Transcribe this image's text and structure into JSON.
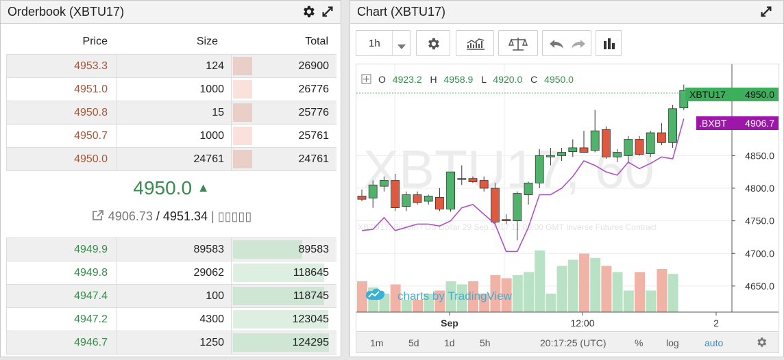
{
  "orderbook": {
    "title": "Orderbook (XBTU17)",
    "headers": {
      "price": "Price",
      "size": "Size",
      "total": "Total"
    },
    "asks": [
      {
        "price": "4953.3",
        "size": "124",
        "total": "26900",
        "depth": 0.2
      },
      {
        "price": "4951.0",
        "size": "1000",
        "total": "26776",
        "depth": 0.2
      },
      {
        "price": "4950.8",
        "size": "15",
        "total": "25776",
        "depth": 0.2
      },
      {
        "price": "4950.7",
        "size": "1000",
        "total": "25761",
        "depth": 0.2
      },
      {
        "price": "4950.0",
        "size": "24761",
        "total": "24761",
        "depth": 0.2
      }
    ],
    "mid": {
      "price": "4950.0",
      "arrow": "▲",
      "index": "4906.73",
      "separator": "/",
      "fair": "4951.34",
      "tail": "| ▯▯▯▯▯"
    },
    "bids": [
      {
        "price": "4949.9",
        "size": "89583",
        "total": "89583",
        "depth": 0.72
      },
      {
        "price": "4949.8",
        "size": "29062",
        "total": "118645",
        "depth": 0.95
      },
      {
        "price": "4947.4",
        "size": "100",
        "total": "118745",
        "depth": 0.95
      },
      {
        "price": "4947.2",
        "size": "4300",
        "total": "123045",
        "depth": 0.99
      },
      {
        "price": "4946.7",
        "size": "1250",
        "total": "124295",
        "depth": 1.0
      }
    ]
  },
  "chart": {
    "title": "Chart (XBTU17)",
    "interval": "1h",
    "legend": {
      "o_label": "O",
      "o": "4923.2",
      "h_label": "H",
      "h": "4958.9",
      "l_label": "L",
      "l": "4920.0",
      "c_label": "C",
      "c": "4950.0"
    },
    "watermark": "XBTU17, 60",
    "subtitle_watermark": "XBTU17: Bitcoin / US Dollar 29 Sep 2017 12:00:00 GMT Inverse Futures Contract",
    "branding": "charts by TradingView",
    "price_labels": [
      {
        "name": "XBTU17",
        "value": "4950.0",
        "color": "#3dae5c"
      },
      {
        "name": ".BXBT",
        "value": "4906.7",
        "color": "#9c16a8"
      }
    ],
    "y_ticks": [
      "4850.0",
      "4800.0",
      "4750.0",
      "4700.0",
      "4650.0"
    ],
    "x_ticks": [
      "Sep",
      "12:00",
      "2"
    ],
    "bottom": {
      "ranges": [
        "1m",
        "5d",
        "1d",
        "5h"
      ],
      "time": "20:17:25 (UTC)",
      "percent": "%",
      "log": "log",
      "auto": "auto"
    },
    "colors": {
      "up": "#4fb36b",
      "down": "#e0583e",
      "index_line": "#b14fc6",
      "vol_up": "#b8e2c3",
      "vol_down": "#f2b3a7"
    }
  },
  "chart_data": {
    "type": "candlestick",
    "title": "XBTU17, 60",
    "ylim": [
      4610,
      4990
    ],
    "candles": [
      {
        "o": 4788,
        "h": 4798,
        "l": 4780,
        "c": 4783
      },
      {
        "o": 4785,
        "h": 4812,
        "l": 4770,
        "c": 4805
      },
      {
        "o": 4803,
        "h": 4818,
        "l": 4795,
        "c": 4812
      },
      {
        "o": 4812,
        "h": 4822,
        "l": 4765,
        "c": 4770
      },
      {
        "o": 4772,
        "h": 4795,
        "l": 4765,
        "c": 4790
      },
      {
        "o": 4790,
        "h": 4795,
        "l": 4775,
        "c": 4778
      },
      {
        "o": 4780,
        "h": 4790,
        "l": 4775,
        "c": 4788
      },
      {
        "o": 4786,
        "h": 4800,
        "l": 4765,
        "c": 4768
      },
      {
        "o": 4768,
        "h": 4825,
        "l": 4764,
        "c": 4825
      },
      {
        "o": 4815,
        "h": 4835,
        "l": 4805,
        "c": 4815
      },
      {
        "o": 4815,
        "h": 4818,
        "l": 4808,
        "c": 4810
      },
      {
        "o": 4812,
        "h": 4818,
        "l": 4795,
        "c": 4800
      },
      {
        "o": 4800,
        "h": 4808,
        "l": 4745,
        "c": 4748
      },
      {
        "o": 4752,
        "h": 4760,
        "l": 4745,
        "c": 4750
      },
      {
        "o": 4750,
        "h": 4795,
        "l": 4720,
        "c": 4792
      },
      {
        "o": 4790,
        "h": 4810,
        "l": 4775,
        "c": 4808
      },
      {
        "o": 4808,
        "h": 4860,
        "l": 4800,
        "c": 4850
      },
      {
        "o": 4848,
        "h": 4862,
        "l": 4835,
        "c": 4850
      },
      {
        "o": 4850,
        "h": 4862,
        "l": 4842,
        "c": 4855
      },
      {
        "o": 4856,
        "h": 4875,
        "l": 4848,
        "c": 4862
      },
      {
        "o": 4862,
        "h": 4888,
        "l": 4855,
        "c": 4855
      },
      {
        "o": 4858,
        "h": 4920,
        "l": 4855,
        "c": 4888
      },
      {
        "o": 4890,
        "h": 4895,
        "l": 4845,
        "c": 4848
      },
      {
        "o": 4848,
        "h": 4860,
        "l": 4840,
        "c": 4855
      },
      {
        "o": 4850,
        "h": 4880,
        "l": 4840,
        "c": 4875
      },
      {
        "o": 4875,
        "h": 4880,
        "l": 4850,
        "c": 4852
      },
      {
        "o": 4853,
        "h": 4888,
        "l": 4848,
        "c": 4885
      },
      {
        "o": 4885,
        "h": 4900,
        "l": 4866,
        "c": 4870
      },
      {
        "o": 4870,
        "h": 4928,
        "l": 4862,
        "c": 4922
      },
      {
        "o": 4923.2,
        "h": 4958.9,
        "l": 4920.0,
        "c": 4950.0
      }
    ],
    "index_line": [
      4735,
      4737,
      4755,
      4735,
      4740,
      4745,
      4745,
      4742,
      4750,
      4770,
      4775,
      4760,
      4745,
      4703,
      4703,
      4740,
      4790,
      4790,
      4800,
      4818,
      4842,
      4835,
      4825,
      4820,
      4840,
      4830,
      4838,
      4848,
      4845,
      4906.7
    ],
    "volumes": [
      0.5,
      0.4,
      0.3,
      0.45,
      0.2,
      0.2,
      0.3,
      0.35,
      0.5,
      0.45,
      0.5,
      0.3,
      0.6,
      0.55,
      0.6,
      0.65,
      1.0,
      0.3,
      0.75,
      0.85,
      0.95,
      0.88,
      0.75,
      0.65,
      0.35,
      0.65,
      0.35,
      0.7,
      0.62,
      0.0
    ],
    "y_ticks": [
      4850,
      4800,
      4750,
      4700,
      4650
    ],
    "x_ticks": [
      "Sep",
      "12:00",
      "2"
    ]
  }
}
